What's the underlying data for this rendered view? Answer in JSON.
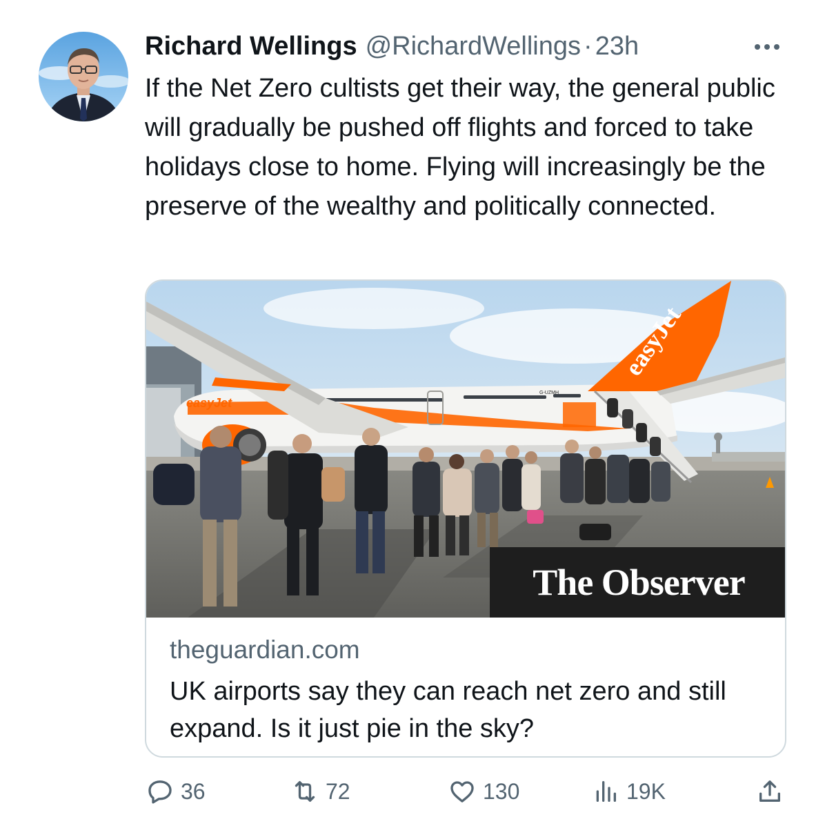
{
  "author": {
    "display_name": "Richard Wellings",
    "handle": "@RichardWellings",
    "separator": "·",
    "time": "23h"
  },
  "tweet": {
    "text": "If the Net Zero cultists get their way, the general public will gradually be pushed off flights and forced to take holidays close to home. Flying will increasingly be the preserve of the wealthy and politically connected."
  },
  "card": {
    "image_badge": "The Observer",
    "image_tail_text": "easyJet",
    "image_registration": "G-UZMH",
    "domain": "theguardian.com",
    "title": "UK airports say they can reach net zero and still expand. Is it just pie in the sky?"
  },
  "actions": {
    "reply_count": "36",
    "retweet_count": "72",
    "like_count": "130",
    "view_count": "19K"
  },
  "icons": {
    "avatar": "profile-photo",
    "more": "more-icon",
    "reply": "reply-icon",
    "retweet": "retweet-icon",
    "like": "heart-icon",
    "views": "views-icon",
    "share": "share-icon"
  },
  "colors": {
    "text": "#0f1419",
    "secondary": "#536471",
    "border": "#cfd9de",
    "easyjet_orange": "#ff6600"
  }
}
